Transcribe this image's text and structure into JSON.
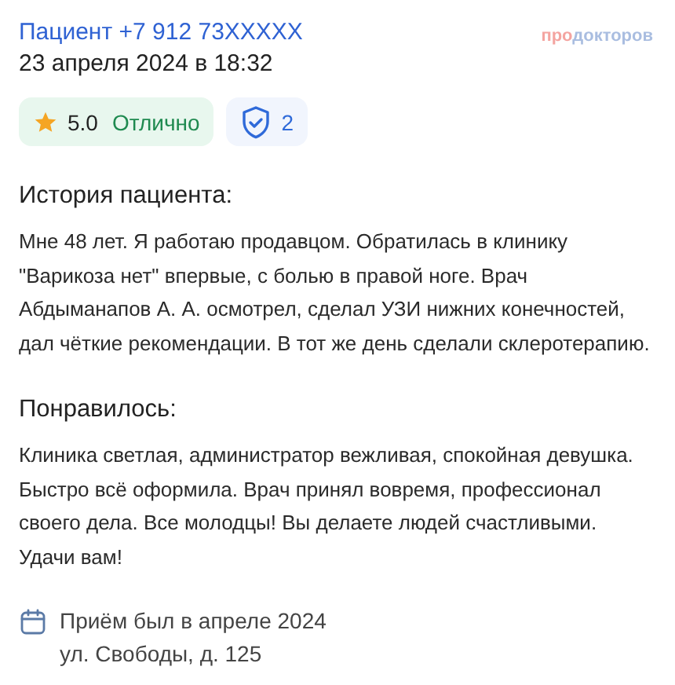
{
  "header": {
    "author": "Пациент +7 912 73XXXXX",
    "date": "23 апреля 2024 в 18:32",
    "logo": {
      "accent": "про",
      "rest": "докторов"
    }
  },
  "rating": {
    "score": "5.0",
    "verdict": "Отлично"
  },
  "verified": {
    "count": "2"
  },
  "sections": [
    {
      "title": "История пациента:",
      "text": "Мне 48 лет. Я работаю продавцом. Обратилась в клинику \"Варикоза нет\" впервые, с болью в правой ноге. Врач Абдыманапов А. А. осмотрел, сделал УЗИ нижних конечностей, дал чёткие рекомендации. В тот же день сделали склеротерапию."
    },
    {
      "title": "Понравилось:",
      "text": "Клиника светлая, администратор вежливая, спокойная девушка. Быстро всё оформила. Врач принял вовремя, профессионал своего дела. Все молодцы! Вы делаете людей счастливыми. Удачи вам!"
    }
  ],
  "visit": {
    "when": "Приём был в апреле 2024",
    "address": "ул. Свободы, д. 125"
  }
}
